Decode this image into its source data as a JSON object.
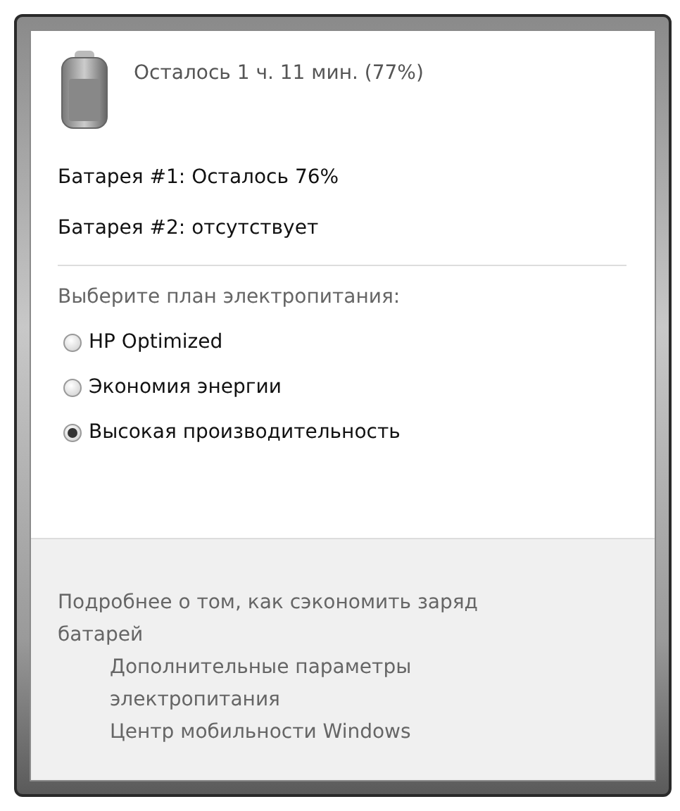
{
  "summary": {
    "text": "Осталось 1 ч. 11 мин. (77%)"
  },
  "batteries": [
    "Батарея #1: Осталось 76%",
    "Батарея #2: отсутствует"
  ],
  "plan_prompt": "Выберите план электропитания:",
  "plans": [
    {
      "label": "HP Optimized",
      "selected": false
    },
    {
      "label": "Экономия энергии",
      "selected": false
    },
    {
      "label": "Высокая производительность",
      "selected": true
    }
  ],
  "links": [
    {
      "text": "Подробнее о том, как сэкономить заряд батарей",
      "indented": false
    },
    {
      "text": "Дополнительные параметры электропитания",
      "indented": true
    },
    {
      "text": "Центр мобильности Windows",
      "indented": true
    }
  ]
}
